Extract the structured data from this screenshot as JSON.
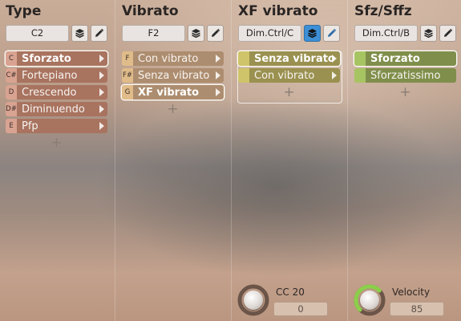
{
  "columns": [
    {
      "title": "Type",
      "key": "C2",
      "articulations": [
        {
          "key": "C",
          "label": "Sforzato",
          "selected": true
        },
        {
          "key": "C#",
          "label": "Fortepiano"
        },
        {
          "key": "D",
          "label": "Crescendo"
        },
        {
          "key": "D#",
          "label": "Diminuendo"
        },
        {
          "key": "E",
          "label": "Pfp"
        }
      ],
      "add_symbol": "+"
    },
    {
      "title": "Vibrato",
      "key": "F2",
      "articulations": [
        {
          "key": "F",
          "label": "Con vibrato"
        },
        {
          "key": "F#",
          "label": "Senza vibrato"
        },
        {
          "key": "G",
          "label": "XF vibrato",
          "selected": true
        }
      ],
      "add_symbol": "+"
    },
    {
      "title": "XF vibrato",
      "key": "Dim.Ctrl/C",
      "layers_active": true,
      "articulations": [
        {
          "label": "Senza vibrato",
          "selected": true
        },
        {
          "label": "Con vibrato"
        }
      ],
      "add_symbol": "+",
      "knob": {
        "label": "CC 20",
        "value": "0",
        "level": 0.0
      }
    },
    {
      "title": "Sfz/Sffz",
      "key": "Dim.Ctrl/B",
      "articulations": [
        {
          "label": "Sforzato",
          "selected": true
        },
        {
          "label": "Sforzatissimo"
        }
      ],
      "add_symbol": "+",
      "knob": {
        "label": "Velocity",
        "value": "85",
        "level": 0.67
      }
    }
  ],
  "icons": {
    "layers": "layers-icon",
    "edit": "pencil-icon"
  },
  "colors": {
    "type_label": "#a8735f",
    "type_key": "#d9a392",
    "vibrato_label": "#ad8d6f",
    "vibrato_key": "#e0bc8a",
    "xf_label": "#9a9150",
    "xf_key": "#cfc46a",
    "sfz_label": "#7f8f4b",
    "sfz_key": "#a7c462",
    "layers_active": "#3d8fd6",
    "velocity_ring": "#8ccf4a"
  }
}
